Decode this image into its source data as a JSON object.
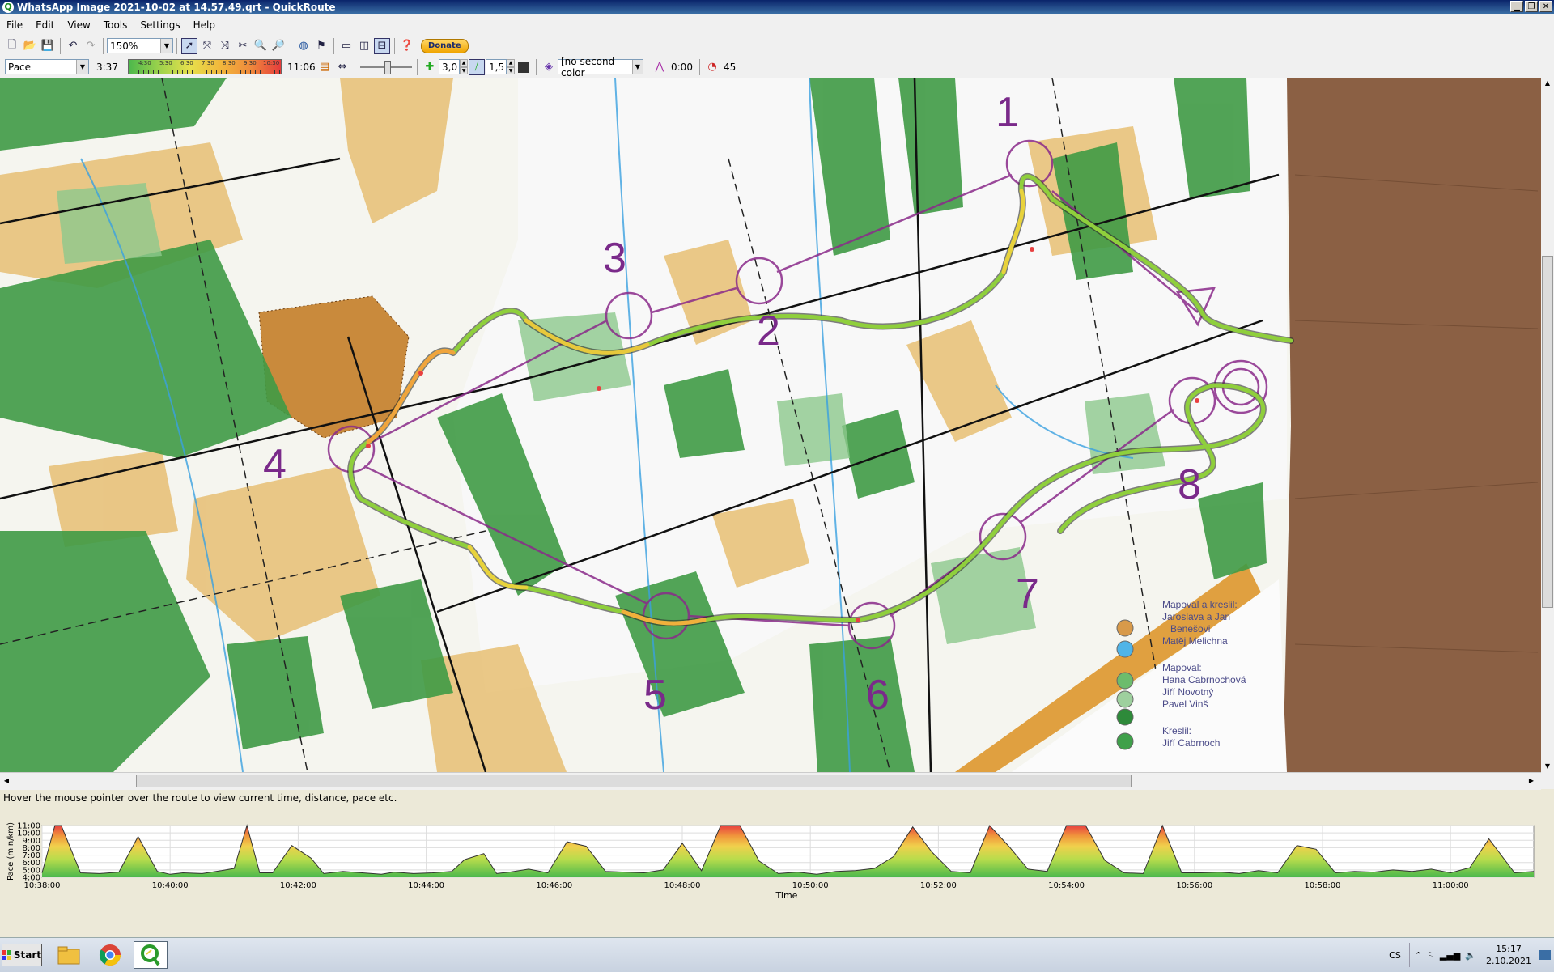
{
  "window": {
    "title": "WhatsApp Image 2021-10-02 at 14.57.49.qrt - QuickRoute"
  },
  "menu": [
    "File",
    "Edit",
    "View",
    "Tools",
    "Settings",
    "Help"
  ],
  "toolbar1": {
    "zoom_value": "150%",
    "donate_label": "Donate",
    "icons": [
      "new-file-icon",
      "open-folder-icon",
      "save-icon",
      "undo-icon",
      "redo-icon",
      "pointer-icon",
      "adjust-route-icon",
      "cut-route-icon",
      "cut-icon",
      "zoom-in-icon",
      "zoom-out-icon",
      "globe-icon",
      "lap-icon",
      "view-map-icon",
      "view-split-icon",
      "view-graph-icon",
      "help-icon"
    ]
  },
  "toolbar2": {
    "attribute_value": "Pace",
    "range_low": "3:37",
    "range_high": "11:06",
    "gradient_labels": [
      "4:30",
      "5:30",
      "6:30",
      "7:30",
      "8:30",
      "9:30",
      "10:30"
    ],
    "route_width": "3,0",
    "mask_width": "1,5",
    "second_color_value": "[no second color",
    "smoothing_value": "0:00",
    "circle_value": "45"
  },
  "map": {
    "control_numbers": [
      "1",
      "2",
      "3",
      "4",
      "5",
      "6",
      "7",
      "8"
    ],
    "legend_lines": [
      "Mapoval a kreslil:",
      "Jaroslava a Jan",
      "Benešovi",
      "Matěj Melichna",
      "Mapoval:",
      "Hana Cabrnochová",
      "Jiří Novotný",
      "Pavel Vinš",
      "Kreslil:",
      "Jiří Cabrnoch"
    ]
  },
  "status": {
    "message": "Hover the mouse pointer over the route to view current time, distance, pace etc."
  },
  "chart_data": {
    "type": "area",
    "title": "",
    "xlabel": "Time",
    "ylabel": "Pace (min/km)",
    "yticks": [
      "11:00",
      "10:00",
      "9:00",
      "8:00",
      "7:00",
      "6:00",
      "5:00",
      "4:00"
    ],
    "ylim": [
      4.0,
      11.0
    ],
    "xticks": [
      "10:38:00",
      "10:40:00",
      "10:42:00",
      "10:44:00",
      "10:46:00",
      "10:48:00",
      "10:50:00",
      "10:52:00",
      "10:54:00",
      "10:56:00",
      "10:58:00",
      "11:00:00"
    ],
    "xlim_minutes_after_1038": [
      0,
      23.3
    ],
    "x": [
      0,
      0.2,
      0.3,
      0.6,
      0.9,
      1.2,
      1.5,
      1.8,
      2.0,
      2.2,
      2.5,
      2.8,
      3.0,
      3.2,
      3.4,
      3.6,
      3.9,
      4.2,
      4.4,
      4.7,
      5.0,
      5.3,
      5.5,
      5.8,
      6.1,
      6.4,
      6.6,
      6.9,
      7.1,
      7.3,
      7.6,
      7.9,
      8.2,
      8.5,
      8.8,
      9.1,
      9.4,
      9.7,
      10.0,
      10.3,
      10.6,
      10.9,
      11.2,
      11.5,
      11.8,
      12.1,
      12.4,
      12.7,
      13.0,
      13.3,
      13.6,
      13.9,
      14.2,
      14.5,
      14.8,
      15.1,
      15.4,
      15.7,
      16.0,
      16.3,
      16.6,
      16.9,
      17.2,
      17.5,
      17.8,
      18.1,
      18.4,
      18.7,
      19.0,
      19.3,
      19.6,
      19.9,
      20.2,
      20.5,
      20.8,
      21.1,
      21.4,
      21.7,
      22.0,
      22.3,
      22.6,
      23.0,
      23.3
    ],
    "values": [
      4.6,
      11.0,
      11.0,
      4.6,
      4.5,
      4.7,
      9.5,
      4.8,
      4.4,
      4.6,
      4.5,
      4.9,
      5.2,
      11.0,
      4.6,
      4.6,
      8.3,
      6.6,
      4.5,
      4.8,
      4.6,
      4.4,
      4.7,
      4.5,
      4.6,
      4.8,
      6.4,
      7.2,
      4.5,
      4.7,
      5.1,
      4.6,
      8.8,
      8.2,
      4.8,
      4.7,
      4.6,
      5.0,
      8.6,
      4.9,
      11.0,
      11.0,
      6.2,
      4.5,
      4.7,
      4.4,
      4.8,
      4.9,
      5.2,
      6.8,
      10.8,
      7.4,
      4.8,
      4.6,
      11.0,
      8.2,
      5.1,
      4.8,
      11.0,
      11.0,
      6.3,
      4.6,
      4.5,
      11.0,
      4.6,
      4.6,
      4.7,
      4.5,
      4.9,
      4.6,
      8.3,
      7.8,
      4.6,
      4.8,
      4.7,
      5.0,
      4.8,
      5.1,
      4.6,
      5.3,
      9.2,
      4.6,
      4.8
    ]
  },
  "taskbar": {
    "start_label": "Start",
    "lang": "CS",
    "time": "15:17",
    "date": "2.10.2021"
  }
}
